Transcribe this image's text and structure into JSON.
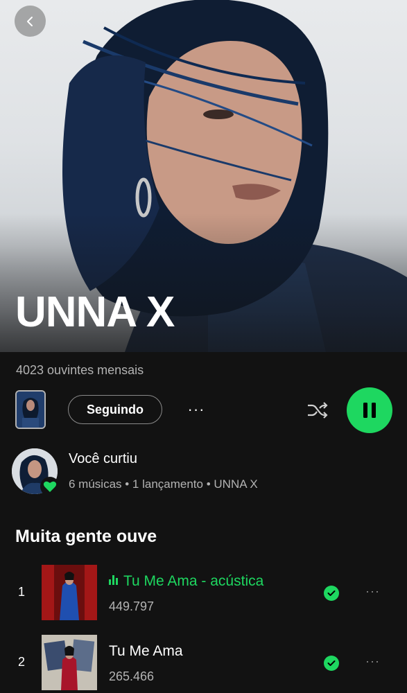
{
  "artist": {
    "name": "UNNA X",
    "monthly_listeners": "4023 ouvintes mensais"
  },
  "actions": {
    "follow_label": "Seguindo",
    "more_label": "···"
  },
  "liked": {
    "title": "Você curtiu",
    "subtitle": "6 músicas • 1 lançamento • UNNA X"
  },
  "popular": {
    "title": "Muita gente ouve",
    "tracks": [
      {
        "number": "1",
        "title": "Tu Me Ama - acústica",
        "plays": "449.797",
        "playing": true
      },
      {
        "number": "2",
        "title": "Tu Me Ama",
        "plays": "265.466",
        "playing": false
      }
    ]
  },
  "colors": {
    "accent": "#1ed760",
    "background": "#121212",
    "secondary_text": "#b3b3b3"
  },
  "icons": [
    "back-arrow-icon",
    "shuffle-icon",
    "pause-icon",
    "heart-icon",
    "check-icon",
    "more-icon"
  ]
}
